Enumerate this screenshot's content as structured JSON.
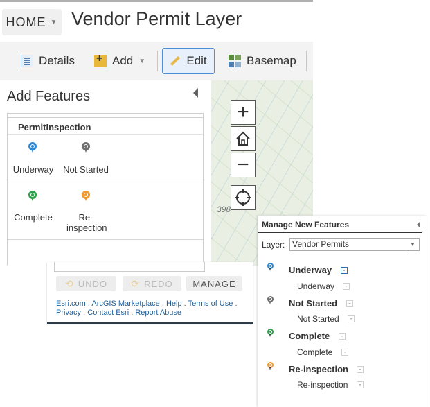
{
  "header": {
    "home_label": "HOME",
    "title": "Vendor Permit Layer"
  },
  "toolbar": {
    "details_label": "Details",
    "add_label": "Add",
    "edit_label": "Edit",
    "basemap_label": "Basemap"
  },
  "map": {
    "zoom_in": "+",
    "zoom_out": "−",
    "home_icon": "home-icon",
    "locate_icon": "locate-icon",
    "partial_label": "398"
  },
  "add_features": {
    "title": "Add Features",
    "layer_name": "PermitInspection",
    "templates": [
      {
        "label": "Underway",
        "color": "#2b86d4"
      },
      {
        "label": "Not Started",
        "color": "#6e6e6e"
      },
      {
        "label": "Complete",
        "color": "#2da24a"
      },
      {
        "label": "Re-inspection",
        "color": "#f39a2f"
      }
    ]
  },
  "bottom_popup": {
    "undo_label": "UNDO",
    "redo_label": "REDO",
    "manage_label": "MANAGE",
    "links": {
      "esri": "Esri.com",
      "marketplace": "ArcGIS Marketplace",
      "help": "Help",
      "terms": "Terms of Use",
      "privacy": "Privacy",
      "contact": "Contact Esri",
      "abuse": "Report Abuse"
    }
  },
  "manage_new_features": {
    "title": "Manage New Features",
    "layer_label": "Layer:",
    "layer_value": "Vendor Permits",
    "items": [
      {
        "name": "Underway",
        "sub": "Underway",
        "color": "#2b86d4"
      },
      {
        "name": "Not Started",
        "sub": "Not Started",
        "color": "#6e6e6e"
      },
      {
        "name": "Complete",
        "sub": "Complete",
        "color": "#2da24a"
      },
      {
        "name": "Re-inspection",
        "sub": "Re-inspection",
        "color": "#f39a2f"
      }
    ]
  },
  "colors": {
    "accent": "#4a90d6",
    "link": "#1f5f9a"
  }
}
